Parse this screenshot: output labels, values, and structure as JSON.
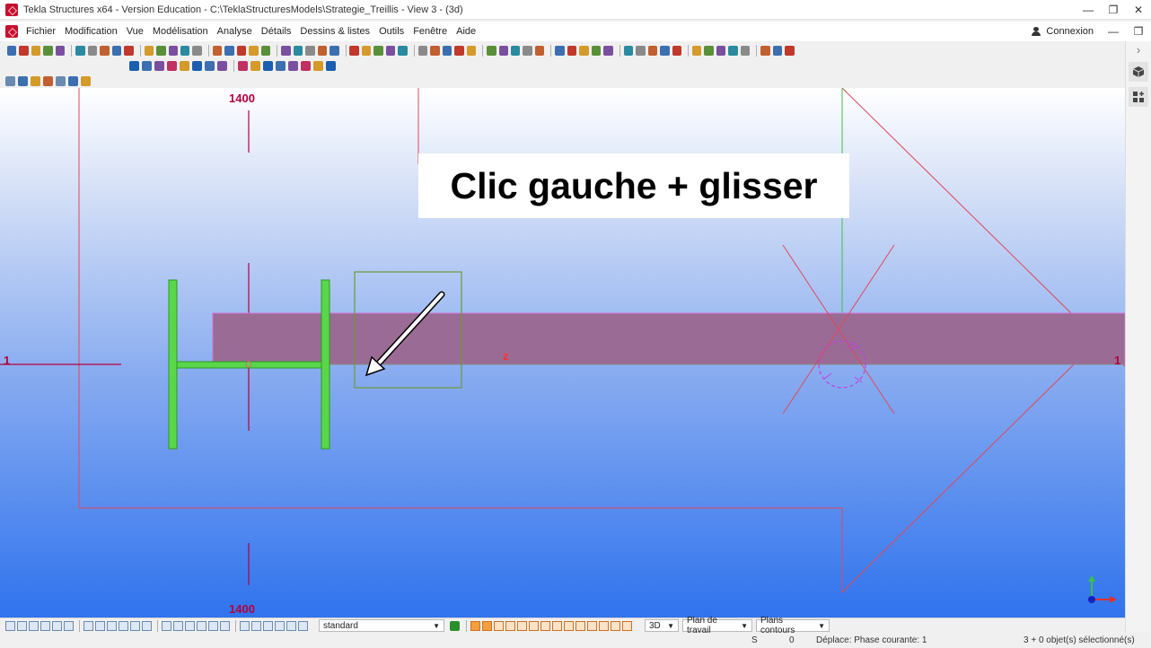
{
  "window": {
    "title": "Tekla Structures x64 - Version Education - C:\\TeklaStructuresModels\\Strategie_Treillis  - View 3 - (3d)",
    "minimize_glyph": "—",
    "restore_glyph": "❐",
    "close_glyph": "✕"
  },
  "menu": {
    "items": [
      "Fichier",
      "Modification",
      "Vue",
      "Modélisation",
      "Analyse",
      "Détails",
      "Dessins & listes",
      "Outils",
      "Fenêtre",
      "Aide"
    ],
    "connexion_label": "Connexion",
    "minimize_glyph": "—",
    "restore_glyph": "❐"
  },
  "right_panel": {
    "chevron": "›"
  },
  "viewport": {
    "overlay_text": "Clic gauche + glisser",
    "grid_label_top": "1400",
    "grid_label_bottom": "1400",
    "grid_label_left": "1",
    "grid_label_right": "1",
    "axis_label": "z",
    "colors": {
      "beam": "#9a6b94",
      "profile": "#5ad64a",
      "grid_line": "#e0485a",
      "grid_text": "#b4003c",
      "selection_box": "#6a9a3a"
    }
  },
  "statusbar": {
    "filter_value": "standard",
    "view_mode": "3D",
    "plan_label": "Plan de travail",
    "contours_label": "Plans contours"
  },
  "bottombar": {
    "snap_letter": "S",
    "count": "0",
    "message": "Déplace: Phase courante: 1",
    "selection": "3 + 0 objet(s) sélectionné(s)"
  }
}
